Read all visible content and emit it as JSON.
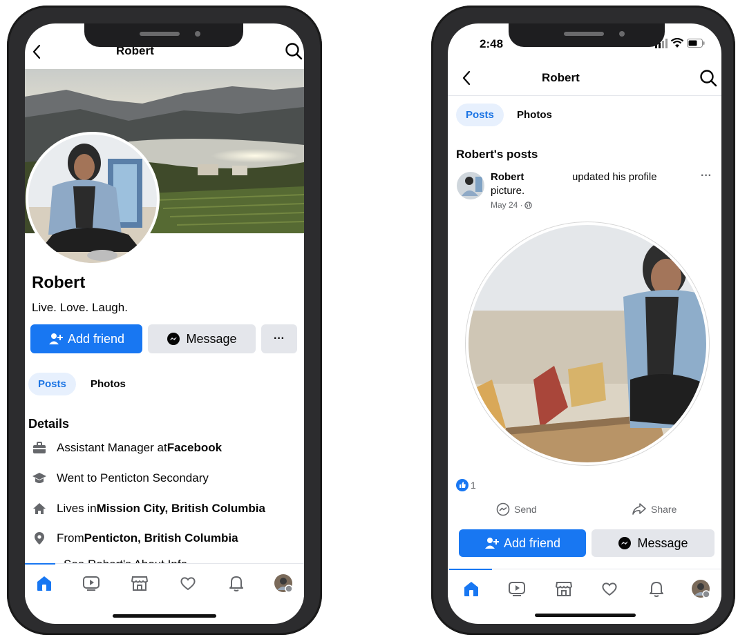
{
  "left": {
    "header": {
      "title": "Robert"
    },
    "profile": {
      "name": "Robert",
      "bio": "Live. Love. Laugh.",
      "add_friend_label": "Add friend",
      "message_label": "Message",
      "more_label": "···"
    },
    "tabs": [
      {
        "label": "Posts",
        "active": true
      },
      {
        "label": "Photos",
        "active": false
      }
    ],
    "details": {
      "heading": "Details",
      "rows": [
        {
          "icon": "briefcase-icon",
          "prefix": "Assistant Manager at ",
          "bold": "Facebook"
        },
        {
          "icon": "graduation-cap-icon",
          "prefix": "Went to Penticton Secondary",
          "bold": ""
        },
        {
          "icon": "house-icon",
          "prefix": "Lives in ",
          "bold": "Mission City, British Columbia"
        },
        {
          "icon": "location-pin-icon",
          "prefix": "From ",
          "bold": "Penticton, British Columbia"
        }
      ],
      "see_about": "See Robert's About Info"
    }
  },
  "right": {
    "status": {
      "time": "2:48"
    },
    "header": {
      "title": "Robert"
    },
    "tabs": [
      {
        "label": "Posts",
        "active": true
      },
      {
        "label": "Photos",
        "active": false
      }
    ],
    "section_title": "Robert's posts",
    "post": {
      "author": "Robert",
      "action": "updated his profile",
      "action_cont": "picture.",
      "meta": "May 24 · ",
      "reactions_count": "1",
      "send_label": "Send",
      "share_label": "Share",
      "more_label": "···"
    },
    "add_friend_label": "Add friend",
    "message_label": "Message"
  },
  "colors": {
    "accent": "#1877f2",
    "pill_bg": "#e7f0fd",
    "gray_button": "#e4e6eb",
    "frame": "#2c2c2e"
  },
  "bottom_nav_icons": [
    "home-icon",
    "video-icon",
    "marketplace-icon",
    "dating-heart-icon",
    "bell-icon",
    "profile-avatar"
  ]
}
